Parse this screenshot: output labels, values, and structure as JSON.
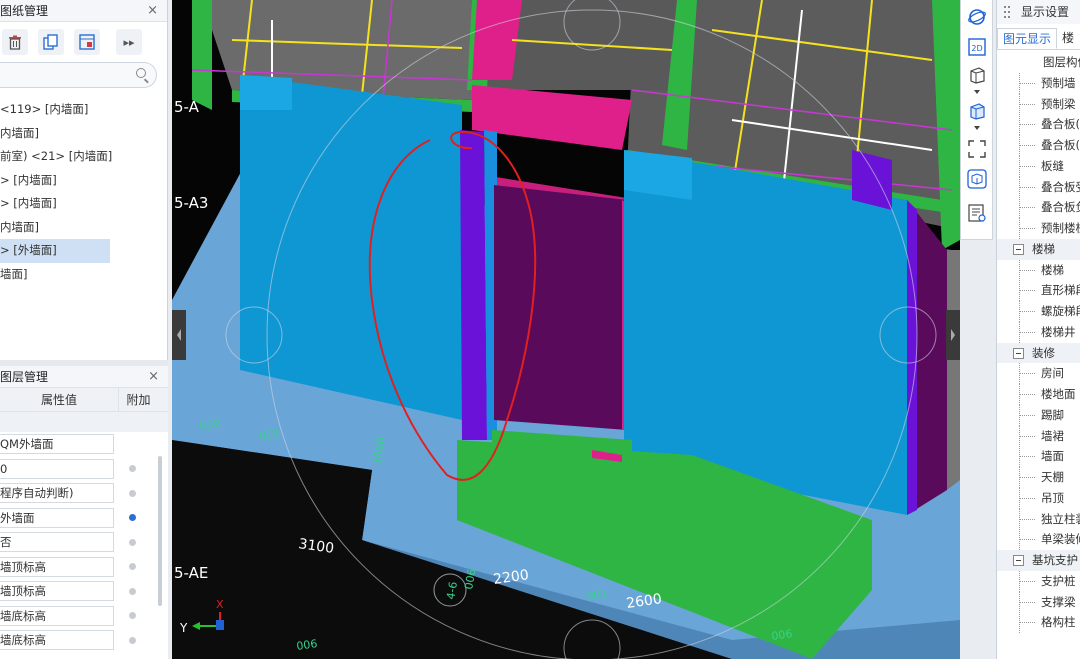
{
  "drawing_panel": {
    "title": "图纸管理",
    "close": "×",
    "more": "▸▸",
    "items": [
      "<119> [内墙面]",
      "内墙面]",
      "前室) <21> [内墙面]",
      "> [内墙面]",
      "> [内墙面]",
      "内墙面]",
      "> [外墙面]",
      "墙面]"
    ],
    "selected_index": 6
  },
  "layer_panel": {
    "title": "图层管理",
    "close": "×",
    "col_value": "属性值",
    "col_extra": "附加",
    "rows": [
      {
        "value": "QM外墙面",
        "dot": null
      },
      {
        "value": "0",
        "dot": "off"
      },
      {
        "value": "程序自动判断)",
        "dot": "off"
      },
      {
        "value": "外墙面",
        "dot": "on"
      },
      {
        "value": "否",
        "dot": "off"
      },
      {
        "value": "墙顶标高",
        "dot": "off"
      },
      {
        "value": "墙顶标高",
        "dot": "off"
      },
      {
        "value": "墙底标高",
        "dot": "off"
      },
      {
        "value": "墙底标高",
        "dot": "off"
      }
    ]
  },
  "viewport": {
    "axis_labels": [
      "5-A",
      "5-A3",
      "5-AE"
    ],
    "dims": [
      "3100",
      "2200",
      "2600"
    ],
    "small_texts": [
      "002",
      "001",
      "1000",
      "4-6",
      "006",
      "001",
      "006",
      "006"
    ],
    "axis_x": "X",
    "axis_y": "Y"
  },
  "toolstrip": [
    "orbit-icon",
    "2d-icon",
    "cube-icon",
    "box-icon",
    "fullscreen-icon",
    "3d-view-icon",
    "layer-props-icon"
  ],
  "strip_labels": {
    "two_d": "2D"
  },
  "display_settings": {
    "title": "显示设置",
    "tabs": [
      "图元显示",
      "楼"
    ],
    "active_tab": 0,
    "items": [
      {
        "label": "图层构件",
        "kind": "top"
      },
      {
        "label": "预制墙",
        "kind": "child"
      },
      {
        "label": "预制梁",
        "kind": "child"
      },
      {
        "label": "叠合板(",
        "kind": "child"
      },
      {
        "label": "叠合板(",
        "kind": "child"
      },
      {
        "label": "板缝",
        "kind": "child"
      },
      {
        "label": "叠合板受",
        "kind": "child"
      },
      {
        "label": "叠合板负",
        "kind": "child"
      },
      {
        "label": "预制楼梯",
        "kind": "child"
      },
      {
        "label": "楼梯",
        "kind": "group"
      },
      {
        "label": "楼梯",
        "kind": "child"
      },
      {
        "label": "直形梯段",
        "kind": "child"
      },
      {
        "label": "螺旋梯段",
        "kind": "child"
      },
      {
        "label": "楼梯井",
        "kind": "child"
      },
      {
        "label": "装修",
        "kind": "group"
      },
      {
        "label": "房间",
        "kind": "child"
      },
      {
        "label": "楼地面",
        "kind": "child"
      },
      {
        "label": "踢脚",
        "kind": "child"
      },
      {
        "label": "墙裙",
        "kind": "child"
      },
      {
        "label": "墙面",
        "kind": "child"
      },
      {
        "label": "天棚",
        "kind": "child"
      },
      {
        "label": "吊顶",
        "kind": "child"
      },
      {
        "label": "独立柱装",
        "kind": "child"
      },
      {
        "label": "单梁装修",
        "kind": "child"
      },
      {
        "label": "基坑支护",
        "kind": "group"
      },
      {
        "label": "支护桩",
        "kind": "child"
      },
      {
        "label": "支撑梁",
        "kind": "child"
      },
      {
        "label": "格构柱",
        "kind": "child"
      }
    ]
  }
}
